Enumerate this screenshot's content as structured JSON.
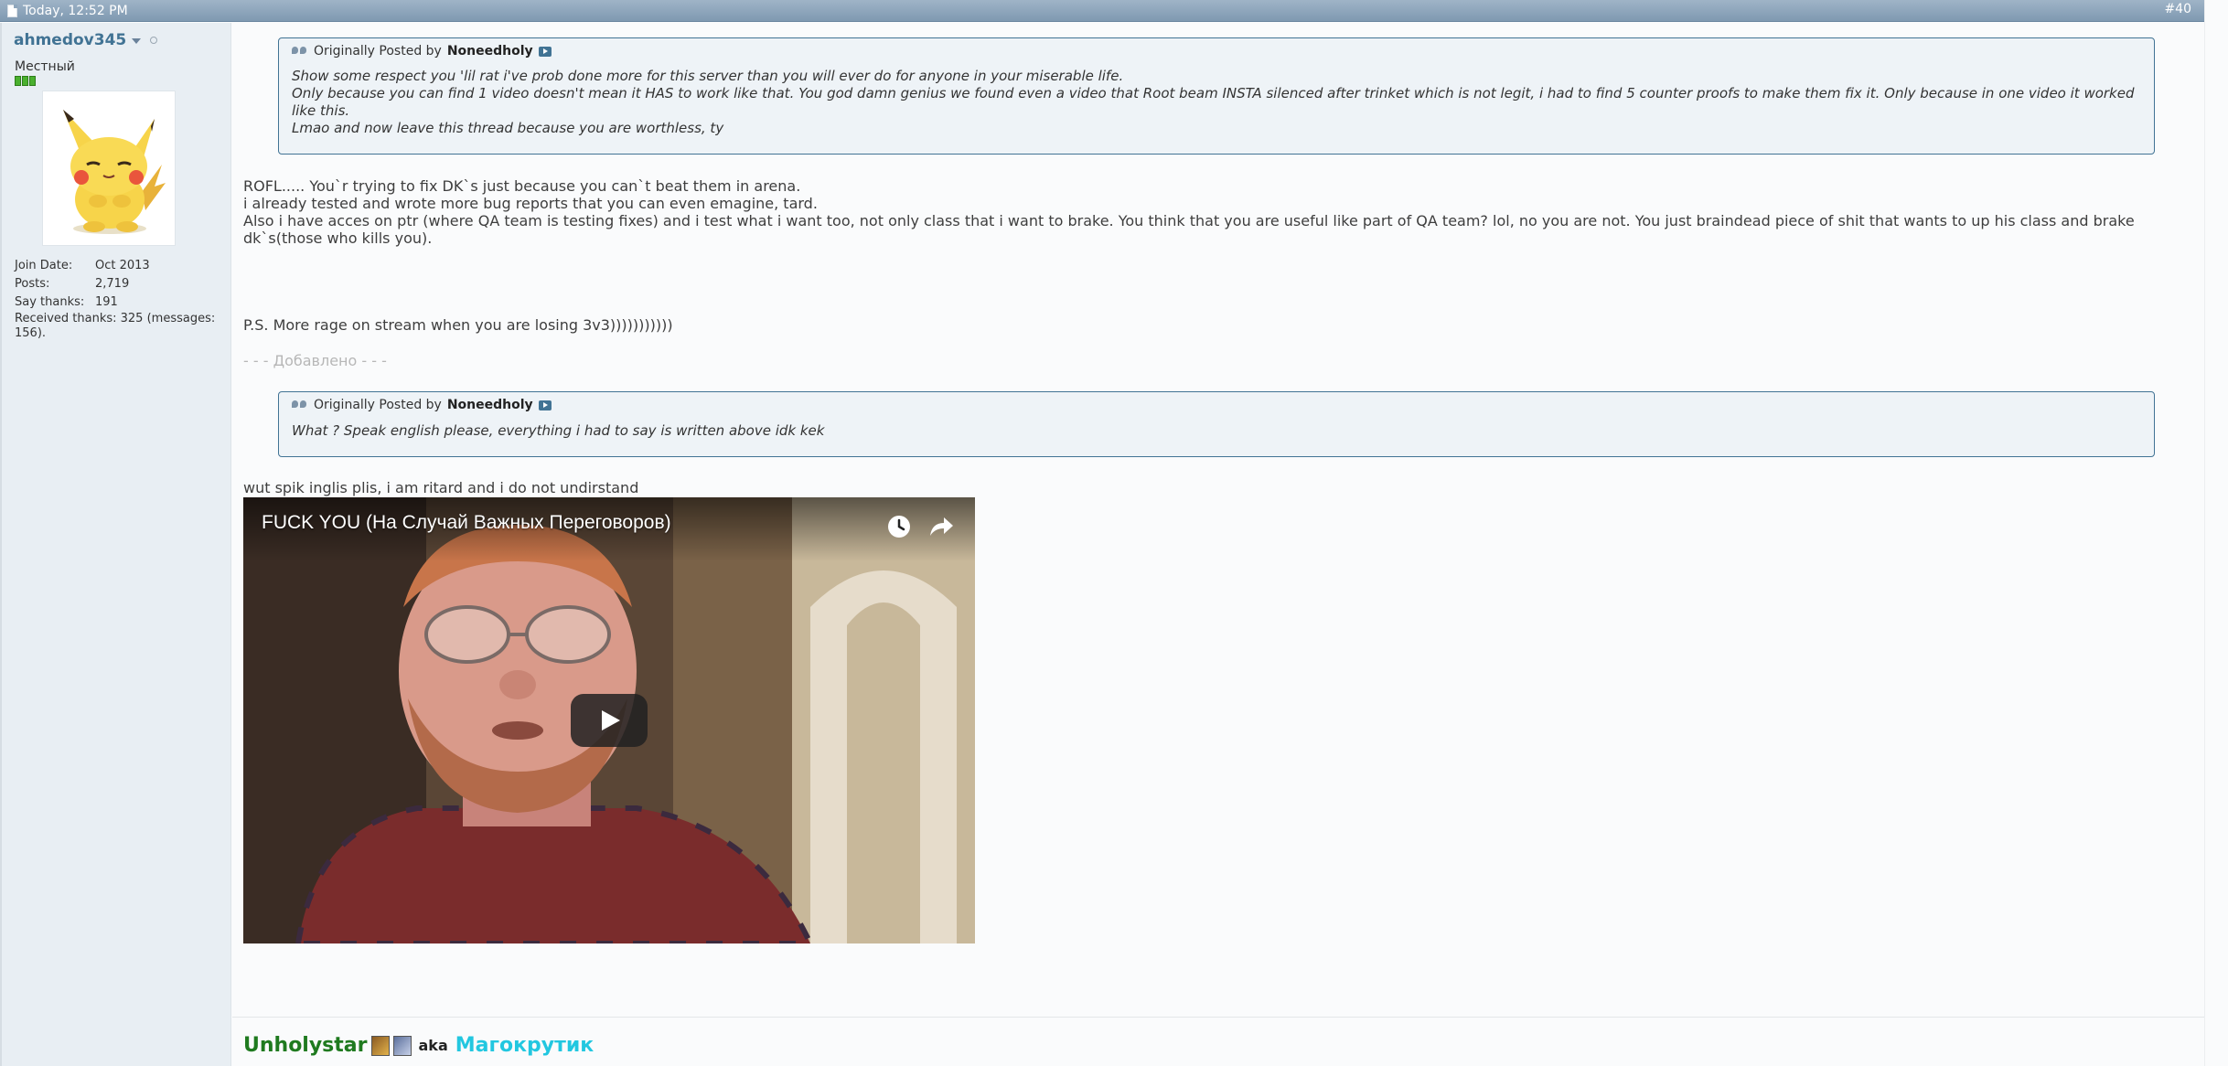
{
  "post": {
    "date": "Today, 12:52 PM",
    "number": "#40"
  },
  "user": {
    "name": "ahmedov345",
    "title": "Местный",
    "avatar_icon": "pikachu-avatar",
    "stats": [
      {
        "label": "Join Date:",
        "value": "Oct 2013"
      },
      {
        "label": "Posts:",
        "value": "2,719"
      },
      {
        "label": "Say thanks:",
        "value": "191"
      }
    ],
    "received_thanks": "Received thanks: 325 (messages: 156)."
  },
  "quote1": {
    "prefix": "Originally Posted by",
    "author": "Noneedholy",
    "lines": [
      "Show some respect you 'lil rat i've prob done more for this server than you will ever do for anyone in your miserable life.",
      "Only because you can find 1 video doesn't mean it HAS to work like that. You god damn genius we found even a video that Root beam INSTA silenced after trinket which is not legit, i had to find 5 counter proofs to make them fix it. Only because in one video it worked like this.",
      "Lmao and now leave this thread because you are worthless, ty"
    ]
  },
  "message": {
    "lines": [
      "ROFL..... You`r trying to fix DK`s just because you can`t beat them in arena.",
      "i already tested and wrote more bug reports that you can even emagine, tard.",
      "Also i have acces on ptr (where QA team is testing fixes) and i test what i want too, not only class that i want to brake. You think that you are useful like part of QA team? lol, no you are not. You just braindead piece of shit that wants to up his class and brake",
      "dk`s(those who kills you)."
    ],
    "ps": "P.S. More rage on stream when you are losing 3v3)))))))))))",
    "added": "- - - Добавлено - - -"
  },
  "quote2": {
    "prefix": "Originally Posted by",
    "author": "Noneedholy",
    "text": "What ? Speak english please, everything i had to say is written above idk kek"
  },
  "reply": "wut spik inglis plis, i am ritard and i do not undirstand",
  "video": {
    "title": "FUCK YOU (На Случай Важных Переговоров)"
  },
  "signature": {
    "name1": "Unholystar",
    "aka": "aka",
    "name2": "Магокрутик"
  }
}
